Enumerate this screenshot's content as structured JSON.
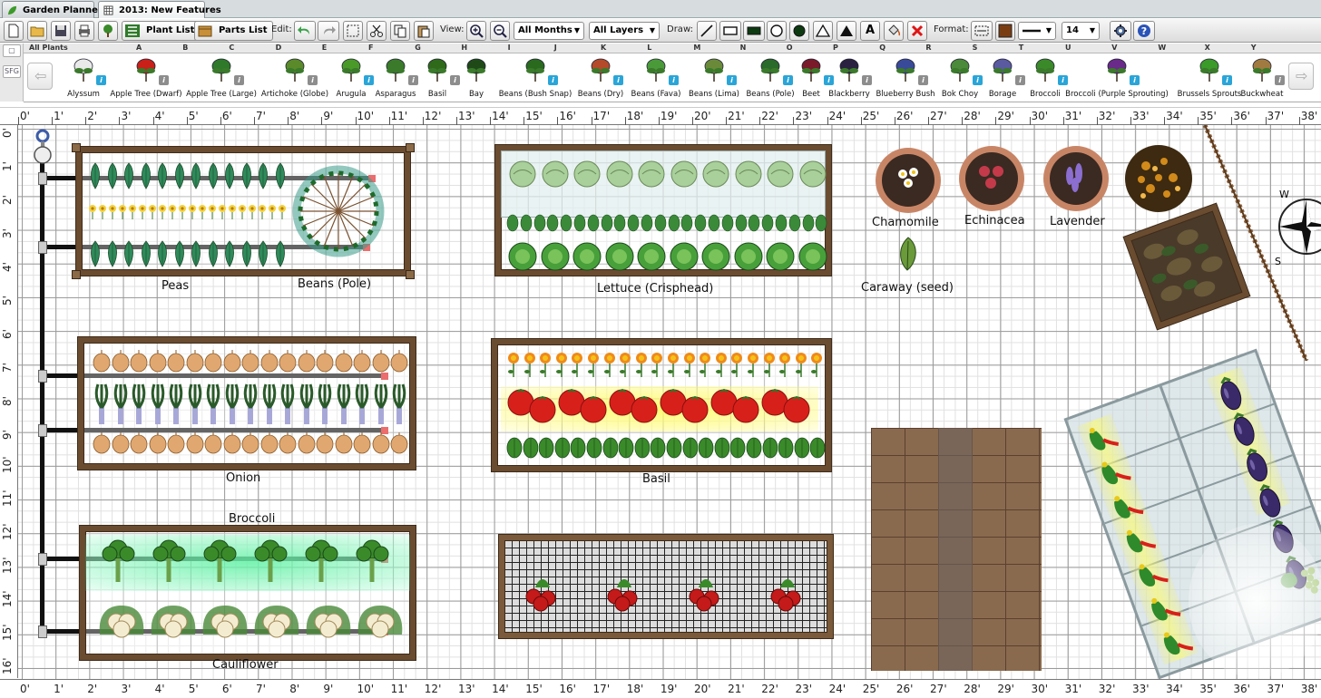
{
  "tabs": [
    {
      "label": "Garden Planner",
      "icon": "leaf-icon"
    },
    {
      "label": "2013: New Features",
      "icon": "grid-icon"
    }
  ],
  "toolbar": {
    "plant_list": "Plant List",
    "parts_list": "Parts List",
    "edit_label": "Edit:",
    "view_label": "View:",
    "months": "All Months",
    "layers": "All Layers",
    "draw_label": "Draw:",
    "text_tool": "A",
    "format_label": "Format:",
    "font_size": "14",
    "fill_color": "#7a3d12"
  },
  "plant_selector": {
    "filter": "All Plants",
    "side_label": "SFG",
    "columns": [
      "A",
      "B",
      "C",
      "D",
      "E",
      "F",
      "G",
      "H",
      "I",
      "J",
      "K",
      "L",
      "M",
      "N",
      "O",
      "P",
      "Q",
      "R",
      "S",
      "T",
      "U",
      "V",
      "W",
      "X",
      "Y"
    ],
    "plants": [
      {
        "name": "Alyssum",
        "info": "blue"
      },
      {
        "name": "Apple Tree (Dwarf)",
        "info": "grey"
      },
      {
        "name": "Apple Tree (Large)",
        "info": "grey"
      },
      {
        "name": "Artichoke (Globe)",
        "info": "grey"
      },
      {
        "name": "Arugula",
        "info": "blue"
      },
      {
        "name": "Asparagus",
        "info": "grey"
      },
      {
        "name": "Basil",
        "info": "grey"
      },
      {
        "name": "Bay",
        "info": ""
      },
      {
        "name": "Beans (Bush Snap)",
        "info": "blue"
      },
      {
        "name": "Beans (Dry)",
        "info": "blue"
      },
      {
        "name": "Beans (Fava)",
        "info": "blue"
      },
      {
        "name": "Beans (Lima)",
        "info": "blue"
      },
      {
        "name": "Beans (Pole)",
        "info": "blue"
      },
      {
        "name": "Beet",
        "info": "blue"
      },
      {
        "name": "Blackberry",
        "info": "grey"
      },
      {
        "name": "Blueberry Bush",
        "info": "grey"
      },
      {
        "name": "Bok Choy",
        "info": "blue"
      },
      {
        "name": "Borage",
        "info": "grey"
      },
      {
        "name": "Broccoli",
        "info": "blue"
      },
      {
        "name": "Broccoli (Purple Sprouting)",
        "info": "blue"
      },
      {
        "name": "Brussels Sprouts",
        "info": "blue"
      },
      {
        "name": "Buckwheat",
        "info": "grey"
      }
    ]
  },
  "rulers": {
    "horizontal": [
      "0'",
      "1'",
      "2'",
      "3'",
      "4'",
      "5'",
      "6'",
      "7'",
      "8'",
      "9'",
      "10'",
      "11'",
      "12'",
      "13'",
      "14'",
      "15'",
      "16'",
      "17'",
      "18'",
      "19'",
      "20'",
      "21'",
      "22'",
      "23'",
      "24'",
      "25'",
      "26'",
      "27'",
      "28'",
      "29'",
      "30'",
      "31'",
      "32'",
      "33'",
      "34'",
      "35'",
      "36'",
      "37'",
      "38'"
    ],
    "vertical": [
      "0'",
      "1'",
      "2'",
      "3'",
      "4'",
      "5'",
      "6'",
      "7'",
      "8'",
      "9'",
      "10'",
      "11'",
      "12'",
      "13'",
      "14'",
      "15'",
      "16'"
    ]
  },
  "garden": {
    "labels": {
      "peas": "Peas",
      "beans_pole": "Beans (Pole)",
      "lettuce": "Lettuce (Crisphead)",
      "chamomile": "Chamomile",
      "echinacea": "Echinacea",
      "lavender": "Lavender",
      "caraway": "Caraway (seed)",
      "onion": "Onion",
      "basil": "Basil",
      "broccoli": "Broccoli",
      "cauliflower": "Cauliflower"
    },
    "compass": {
      "w": "W",
      "s": "S"
    }
  }
}
